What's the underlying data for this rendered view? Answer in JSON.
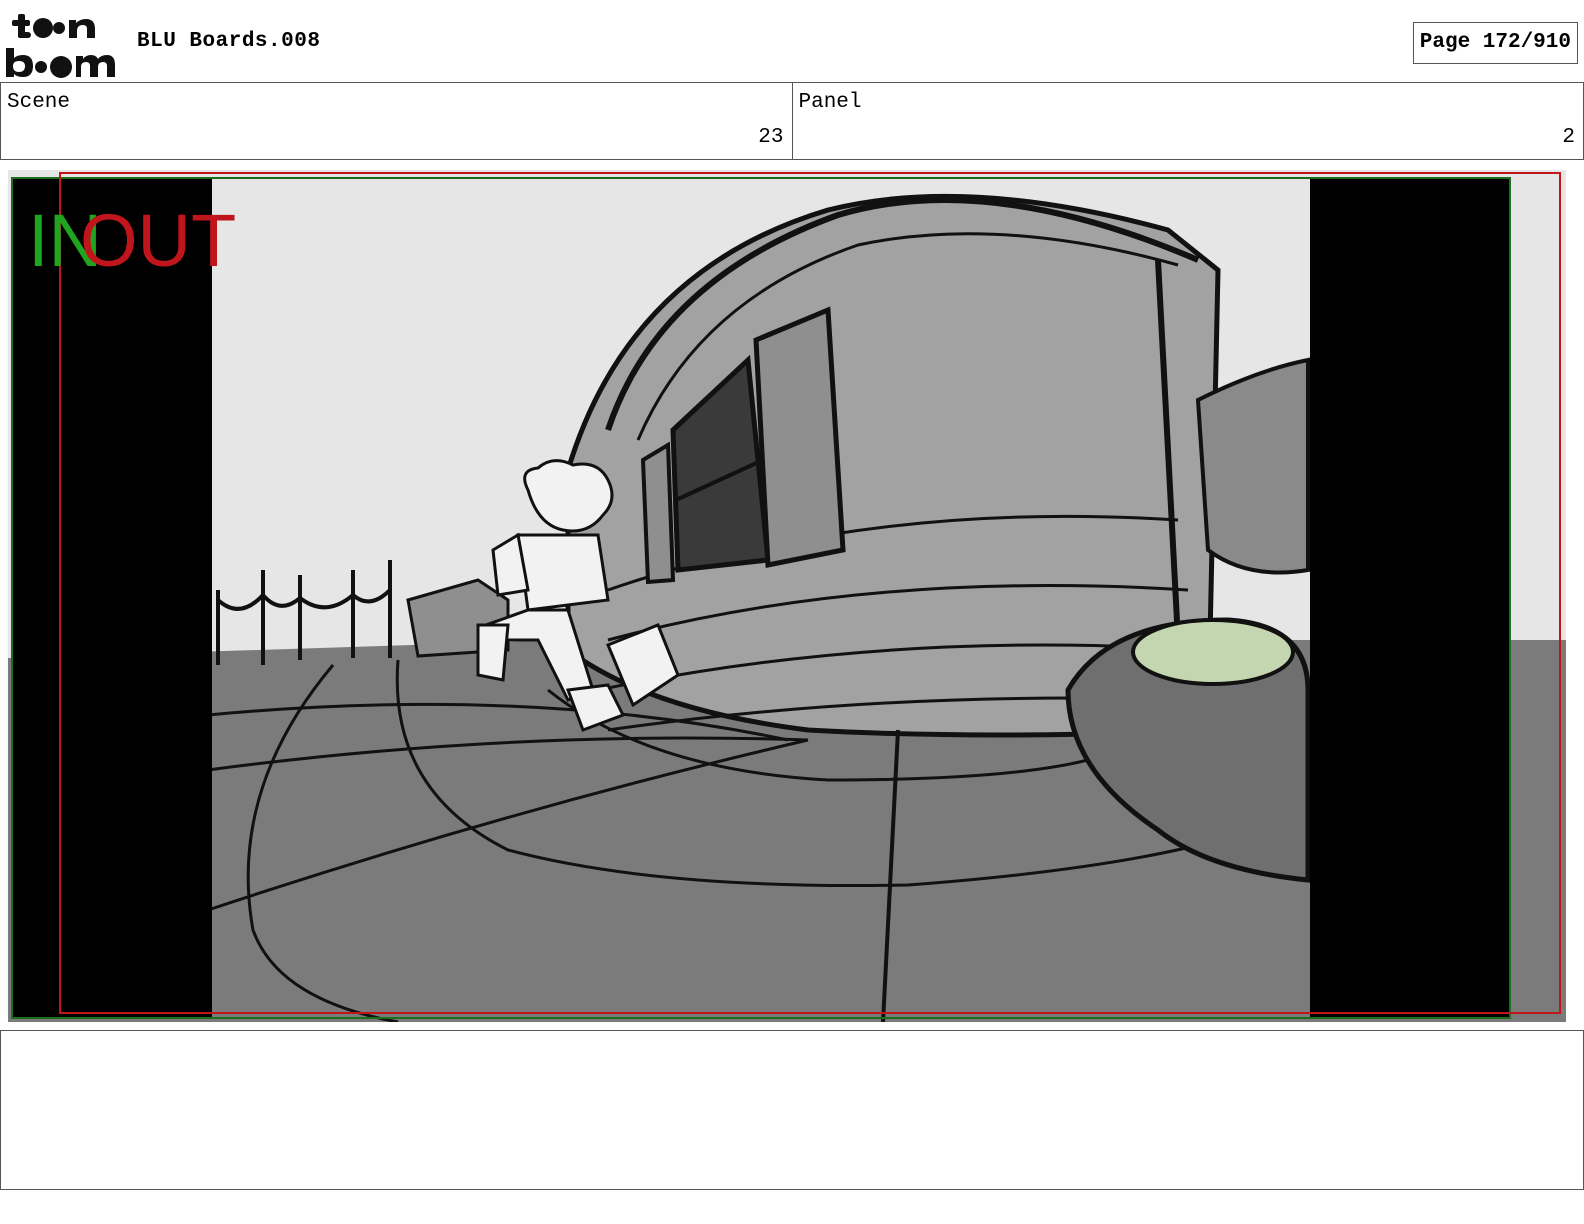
{
  "header": {
    "logo_top": "toon",
    "logo_bottom": "boom",
    "document_title": "BLU Boards.008",
    "page_indicator": "Page 172/910"
  },
  "info": {
    "scene_label": "Scene",
    "scene_value": "23",
    "panel_label": "Panel",
    "panel_value": "2"
  },
  "panel": {
    "in_marker": "IN",
    "out_marker": "OUT",
    "in_color": "#1fa51f",
    "out_color": "#c0161b",
    "description_colors": {
      "sky": "#e6e6e6",
      "ground": "#7b7b7b",
      "building": "#a2a2a2",
      "letterbox": "#000000",
      "lid": "#c4d6b0"
    }
  },
  "caption": {
    "text": ""
  }
}
